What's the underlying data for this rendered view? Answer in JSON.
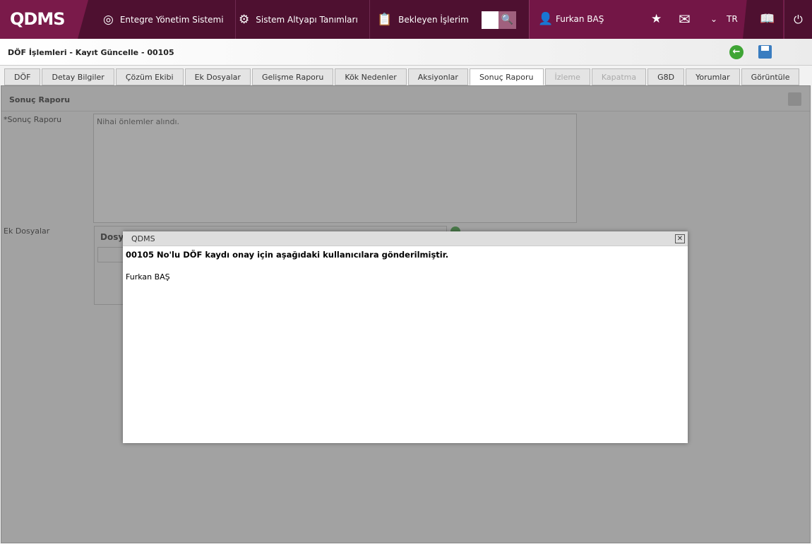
{
  "header": {
    "logo": "QDMS",
    "nav": [
      "Entegre Yönetim Sistemi",
      "Sistem Altyapı Tanımları",
      "Bekleyen İşlerim"
    ],
    "user": "Furkan BAŞ",
    "lang": "TR"
  },
  "page": {
    "title": "DÖF İşlemleri - Kayıt Güncelle - 00105"
  },
  "tabs": [
    "DÖF",
    "Detay Bilgiler",
    "Çözüm Ekibi",
    "Ek Dosyalar",
    "Gelişme Raporu",
    "Kök Nedenler",
    "Aksiyonlar",
    "Sonuç Raporu",
    "İzleme",
    "Kapatma",
    "G8D",
    "Yorumlar",
    "Görüntüle"
  ],
  "content": {
    "section": "Sonuç Raporu",
    "field_label": "*Sonuç Raporu",
    "field_value": "Nihai önlemler alındı.",
    "files_label": "Ek Dosyalar",
    "files_header": "Dosya"
  },
  "modal": {
    "title": "QDMS",
    "message": "00105 No'lu DÖF kaydı onay için aşağıdaki kullanıcılara gönderilmiştir.",
    "user": "Furkan BAŞ",
    "close": "✕"
  }
}
